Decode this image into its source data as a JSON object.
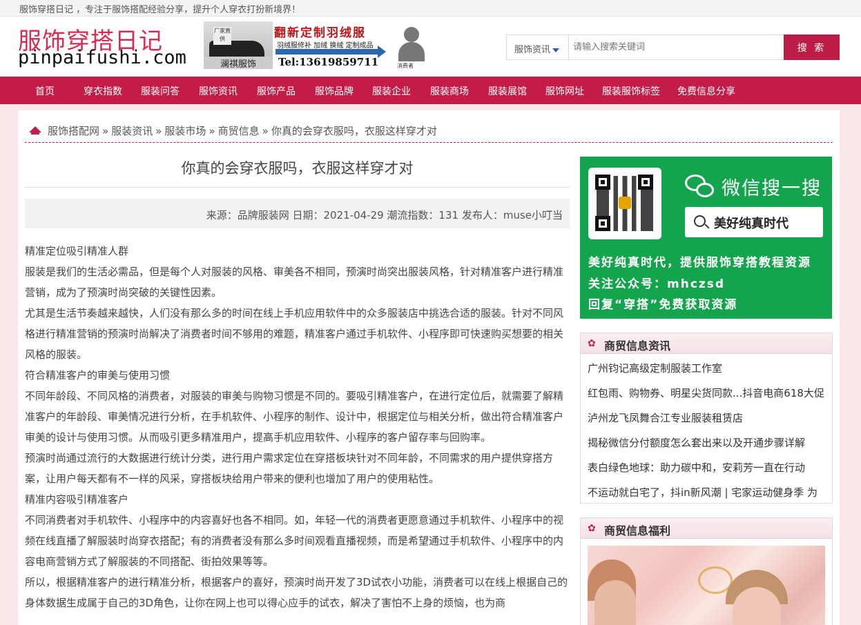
{
  "topbar": {
    "slogan": "服饰穿搭日记 ，专注于服饰搭配经验分享，提升个人穿衣打扮新境界！"
  },
  "header": {
    "logo_cn": "服饰穿搭日记",
    "logo_en": "pinpaifushi.com",
    "banner": {
      "title": "翻新定制羽绒服",
      "subtitle": "羽绒服修补 加绒 换绒 定制成品",
      "tag": "厂家直供",
      "shop_name": "澜祺服饰",
      "phone": "Tel:13619859711",
      "caption": "消费者"
    }
  },
  "search": {
    "category": "服饰资讯",
    "placeholder": "请输入搜索关键词",
    "button": "搜 索"
  },
  "nav": {
    "items": [
      "首页",
      "穿衣指数",
      "服装问答",
      "服饰资讯",
      "服饰产品",
      "服饰品牌",
      "服装企业",
      "服装商场",
      "服装展馆",
      "服饰网址",
      "服装服饰标签",
      "免费信息分享"
    ]
  },
  "breadcrumb": {
    "items": [
      "服饰搭配网",
      "服装资讯",
      "服装市场",
      "商贸信息"
    ],
    "current": "你真的会穿衣服吗，衣服这样穿才对",
    "separator": "»"
  },
  "article": {
    "title": "你真的会穿衣服吗，衣服这样穿才对",
    "meta": "来源：品牌服装网 日期：2021-04-29 潮流指数：131 发布人：muse小叮当",
    "paragraphs": [
      "精准定位吸引精准人群",
      "服装是我们的生活必需品，但是每个人对服装的风格、审美各不相同，预演时尚突出服装风格，针对精准客户进行精准营销，成为了预演时尚突破的关键性因素。",
      "尤其是生活节奏越来越快，人们没有那么多的时间在线上手机应用软件中的众多服装店中挑选合适的服装。针对不同风格进行精准营销的预演时尚解决了消费者时间不够用的难题，精准客户通过手机软件、小程序即可快速购买想要的相关风格的服装。",
      "符合精准客户的审美与使用习惯",
      "不同年龄段、不同风格的消费者，对服装的审美与购物习惯是不同的。要吸引精准客户，在进行定位后，就需要了解精准客户的年龄段、审美情况进行分析，在手机软件、小程序的制作、设计中，根据定位与相关分析，做出符合精准客户审美的设计与使用习惯。从而吸引更多精准用户，提高手机应用软件、小程序的客户留存率与回购率。",
      "预演时尚通过流行的大数据进行统计分类，进行用户需求定位在穿搭板块针对不同年龄，不同需求的用户提供穿搭方案，让用户每天都有不一样的风采，穿搭板块给用户带来的便利也增加了用户的使用粘性。",
      "精准内容吸引精准客户",
      "不同消费者对手机软件、小程序中的内容喜好也各不相同。如，年轻一代的消费者更愿意通过手机软件、小程序中的视频在线直播了解服装时尚穿衣搭配；有的消费者没有那么多时间观看直播视频，而是希望通过手机软件、小程序中的内容电商营销方式了解服装的不同搭配、街拍效果等等。",
      "所以，根据精准客户的进行精准分析，根据客户的喜好，预演时尚开发了3D试衣小功能，消费者可以在线上根据自己的身体数据生成属于自己的3D角色，让你在网上也可以得心应手的试衣，解决了害怕不上身的烦恼，也为商"
    ]
  },
  "wechat": {
    "title": "微信搜一搜",
    "search_text": "美好纯真时代",
    "lines": [
      "美好纯真时代，提供服饰穿搭教程资源",
      "关注公众号：mhczsd",
      "回复“穿搭”免费获取资源"
    ]
  },
  "news_box": {
    "title": "商贸信息资讯",
    "items": [
      "广州钧记高级定制服装工作室",
      "红包雨、购物券、明星尖货同款...抖音电商618大促",
      "泸州龙飞凤舞合江专业服装租赁店",
      "揭秘微信分付额度怎么套出来以及开通步骤详解",
      "表白绿色地球：助力碳中和，安莉芳一直在行动",
      "不运动就白宅了，抖in新风潮 | 宅家运动健身季 为"
    ]
  },
  "welfare_box": {
    "title": "商贸信息福利"
  },
  "colors": {
    "brand": "#c41c49",
    "wechat_green": "#14a44d"
  }
}
